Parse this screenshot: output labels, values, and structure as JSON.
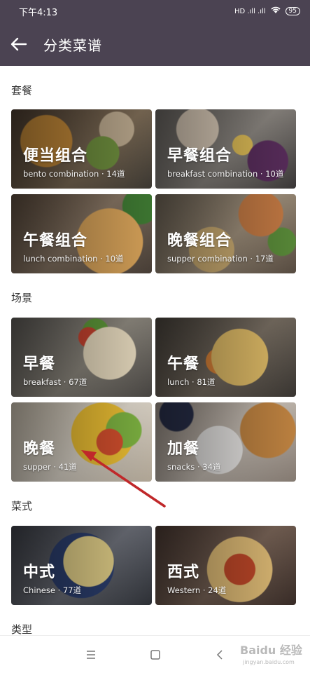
{
  "status_bar": {
    "time": "下午4:13",
    "signal": "HD .ıll .ıll",
    "battery": "95"
  },
  "app_bar": {
    "title": "分类菜谱"
  },
  "sections": [
    {
      "title": "套餐",
      "cards": [
        {
          "name": "便当组合",
          "sub": "bento combination · 14道"
        },
        {
          "name": "早餐组合",
          "sub": "breakfast combination · 10道"
        },
        {
          "name": "午餐组合",
          "sub": "lunch combination · 10道"
        },
        {
          "name": "晚餐组合",
          "sub": "supper combination · 17道"
        }
      ]
    },
    {
      "title": "场景",
      "cards": [
        {
          "name": "早餐",
          "sub": "breakfast · 67道"
        },
        {
          "name": "午餐",
          "sub": "lunch · 81道"
        },
        {
          "name": "晚餐",
          "sub": "supper · 41道"
        },
        {
          "name": "加餐",
          "sub": "snacks · 34道"
        }
      ]
    },
    {
      "title": "菜式",
      "cards": [
        {
          "name": "中式",
          "sub": "Chinese · 77道"
        },
        {
          "name": "西式",
          "sub": "Western · 24道"
        }
      ]
    },
    {
      "title": "类型",
      "cards": []
    }
  ],
  "watermark": {
    "main": "Baidu 经验",
    "sub": "jingyan.baidu.com"
  },
  "colors": {
    "appbar": "#4b4352",
    "arrow": "#c0282a"
  }
}
